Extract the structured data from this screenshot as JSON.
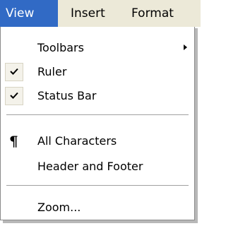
{
  "menubar": {
    "items": [
      {
        "label": "View",
        "active": true
      },
      {
        "label": "Insert",
        "active": false
      },
      {
        "label": "Format",
        "active": false
      }
    ]
  },
  "dropdown": {
    "items": [
      {
        "label": "Toolbars",
        "submenu": true,
        "checked": false,
        "icon": "submenu-arrow-icon"
      },
      {
        "label": "Ruler",
        "submenu": false,
        "checked": true,
        "icon": "checkmark-icon"
      },
      {
        "label": "Status Bar",
        "submenu": false,
        "checked": true,
        "icon": "checkmark-icon"
      },
      {
        "label": "All Characters",
        "submenu": false,
        "checked": false,
        "icon": "pilcrow-icon"
      },
      {
        "label": "Header and Footer",
        "submenu": false,
        "checked": false
      },
      {
        "label": "Zoom...",
        "submenu": false,
        "checked": false
      }
    ]
  },
  "colors": {
    "highlight": "#316ac5",
    "menubar_bg": "#ece9d8",
    "check_bg": "#f4f2ea"
  }
}
